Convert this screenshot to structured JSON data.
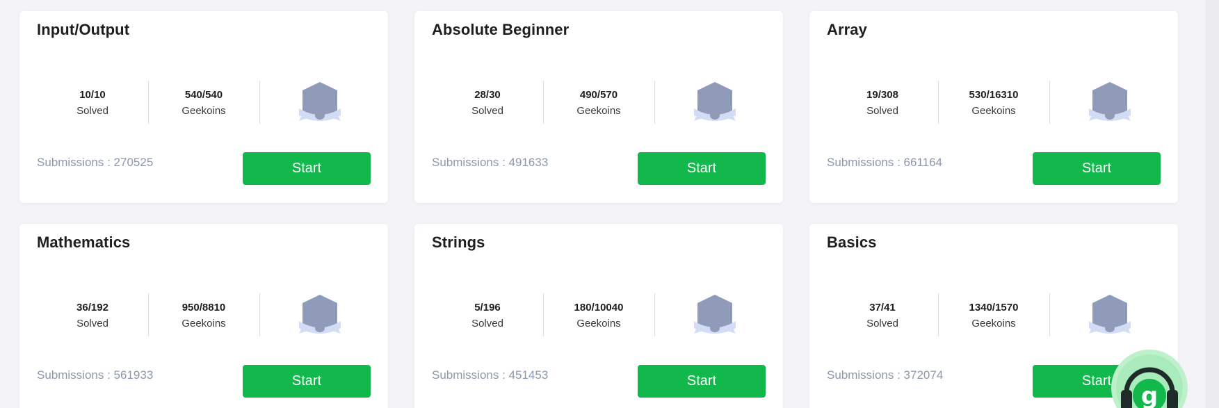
{
  "cards": [
    {
      "title": "Input/Output",
      "solved_value": "10/10",
      "solved_label": "Solved",
      "geekoins_value": "540/540",
      "geekoins_label": "Geekoins",
      "submissions": "Submissions : 270525",
      "start_label": "Start",
      "badge_icon": "badge-shield-icon"
    },
    {
      "title": "Absolute Beginner",
      "solved_value": "28/30",
      "solved_label": "Solved",
      "geekoins_value": "490/570",
      "geekoins_label": "Geekoins",
      "submissions": "Submissions : 491633",
      "start_label": "Start",
      "badge_icon": "badge-shield-icon"
    },
    {
      "title": "Array",
      "solved_value": "19/308",
      "solved_label": "Solved",
      "geekoins_value": "530/16310",
      "geekoins_label": "Geekoins",
      "submissions": "Submissions : 661164",
      "start_label": "Start",
      "badge_icon": "badge-shield-icon"
    },
    {
      "title": "Mathematics",
      "solved_value": "36/192",
      "solved_label": "Solved",
      "geekoins_value": "950/8810",
      "geekoins_label": "Geekoins",
      "submissions": "Submissions : 561933",
      "start_label": "Start",
      "badge_icon": "badge-shield-icon"
    },
    {
      "title": "Strings",
      "solved_value": "5/196",
      "solved_label": "Solved",
      "geekoins_value": "180/10040",
      "geekoins_label": "Geekoins",
      "submissions": "Submissions : 451453",
      "start_label": "Start",
      "badge_icon": "badge-shield-icon"
    },
    {
      "title": "Basics",
      "solved_value": "37/41",
      "solved_label": "Solved",
      "geekoins_value": "1340/1570",
      "geekoins_label": "Geekoins",
      "submissions": "Submissions : 372074",
      "start_label": "Start",
      "badge_icon": "badge-shield-icon"
    }
  ],
  "help_widget": {
    "icon": "headphones-support-icon"
  },
  "colors": {
    "accent_green": "#12b84c",
    "badge_gray": "#8f9bb8",
    "badge_ribbon": "#d3dcf5",
    "muted_text": "#8c98ab",
    "page_bg": "#f4f4f8"
  }
}
